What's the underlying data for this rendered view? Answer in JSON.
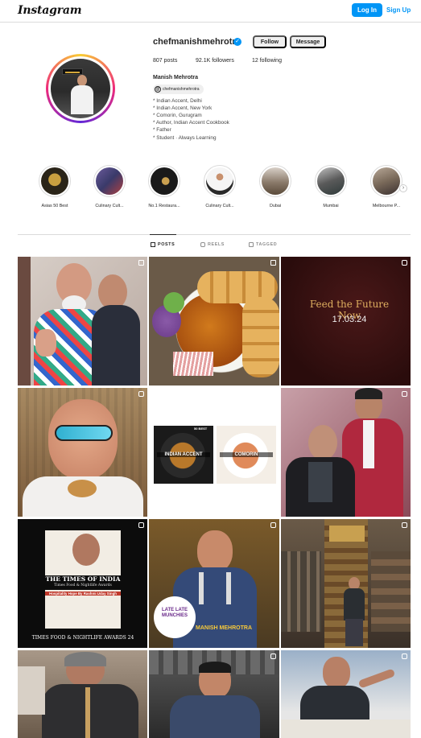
{
  "header": {
    "logo": "Instagram",
    "login_label": "Log In",
    "signup_label": "Sign Up"
  },
  "profile": {
    "username": "chefmanishmehrotra",
    "verified": true,
    "follow_label": "Follow",
    "message_label": "Message",
    "stats": {
      "posts": "807 posts",
      "followers": "92.1K followers",
      "following": "12 following"
    },
    "full_name": "Manish Mehrotra",
    "threads_handle": "chefmanishmehrotra",
    "bio": [
      "* Indian Accent, Delhi",
      "* Indian Accent, New York",
      "* Comorin, Gurugram",
      "* Author, Indian Accent Cookbook",
      "* Father",
      "* Student · Always Learning"
    ]
  },
  "highlights": [
    {
      "label": "Asias 50 Best",
      "color": "#2a2418"
    },
    {
      "label": "Culinary Cult...",
      "color": "#4a4a78"
    },
    {
      "label": "No.1 Restaura...",
      "color": "#1a1a1a"
    },
    {
      "label": "Culinary Cult...",
      "color": "#e9e9e9"
    },
    {
      "label": "Dubai",
      "color": "#8a7a6a"
    },
    {
      "label": "Mumbai",
      "color": "#5a5a5a"
    },
    {
      "label": "Melbourne P...",
      "color": "#7a6a5a"
    }
  ],
  "tabs": [
    {
      "label": "POSTS",
      "active": true
    },
    {
      "label": "REELS",
      "active": false
    },
    {
      "label": "TAGGED",
      "active": false
    }
  ],
  "posts": {
    "feed_title": "Feed the Future Now",
    "feed_date": "17.03.24",
    "award_left": "INDIAN ACCENT",
    "award_right": "COMORIN",
    "award_badge": "50 BEST",
    "times_title": "THE TIMES OF INDIA",
    "times_sub": "Times Food & Nightlife Awards",
    "times_headline": "Hospitality Hope By Rashmi Uday Singh",
    "times_footer": "TIMES FOOD & NIGHTLIFE AWARDS 24",
    "late_badge": "LATE LATE MUNCHIES",
    "late_name": "MANISH MEHROTRA"
  }
}
